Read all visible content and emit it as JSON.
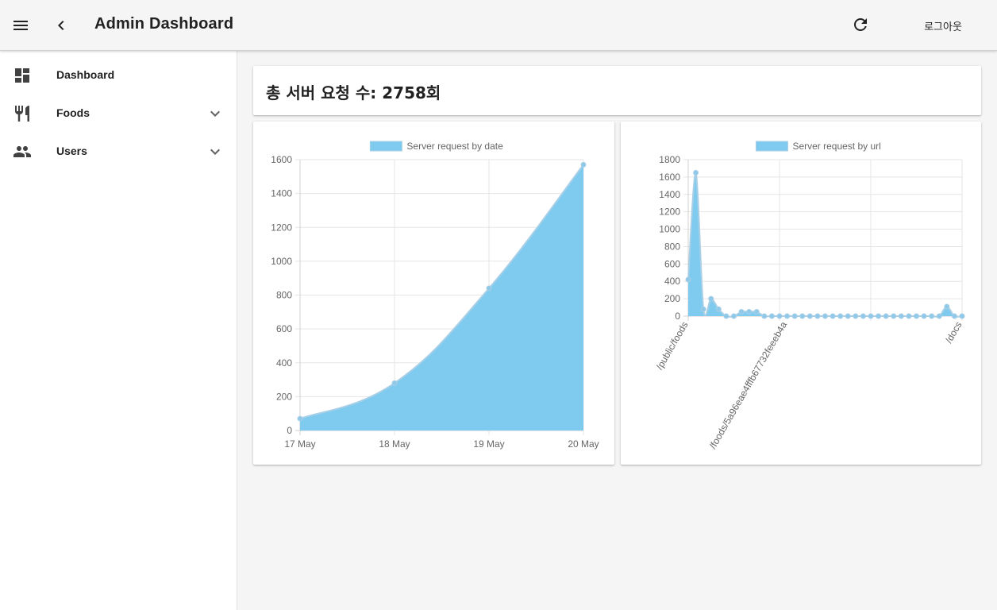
{
  "header": {
    "title": "Admin Dashboard",
    "logout_label": "로그아웃",
    "icons": [
      "menu-icon",
      "back-chevron-icon",
      "refresh-icon"
    ]
  },
  "sidebar": {
    "items": [
      {
        "label": "Dashboard",
        "icon": "dashboard-icon",
        "expandable": false
      },
      {
        "label": "Foods",
        "icon": "restaurant-icon",
        "expandable": true
      },
      {
        "label": "Users",
        "icon": "people-icon",
        "expandable": true
      }
    ]
  },
  "summary": {
    "total_requests": "총 서버 요청 수: 2758회"
  },
  "colors": {
    "fill": "#7ecbef",
    "stroke": "#a9cfe6",
    "point": "#8fc9ea",
    "grid": "#e5e5e5",
    "axis": "#d0d0d0"
  },
  "chart_data": [
    {
      "type": "area",
      "legend": "Server request by date",
      "categories": [
        "17 May",
        "18 May",
        "19 May",
        "20 May"
      ],
      "values": [
        70,
        280,
        840,
        1570
      ],
      "ylim": [
        0,
        1600
      ],
      "yticks": [
        0,
        200,
        400,
        600,
        800,
        1000,
        1200,
        1400,
        1600
      ],
      "grid": true,
      "legend_position": "top"
    },
    {
      "type": "area",
      "legend": "Server request by url",
      "point_count": 37,
      "values": [
        420,
        1650,
        80,
        200,
        80,
        0,
        0,
        50,
        50,
        50,
        0,
        0,
        0,
        0,
        0,
        0,
        0,
        0,
        0,
        0,
        0,
        0,
        0,
        0,
        0,
        0,
        0,
        0,
        0,
        0,
        0,
        0,
        0,
        0,
        110,
        0,
        0
      ],
      "visible_tick_labels": [
        {
          "index": 0,
          "label": "/public/foods"
        },
        {
          "index": 13,
          "label": "/foods/5a96eae4fffb67732feeeb4a"
        },
        {
          "index": 36,
          "label": "/docs"
        }
      ],
      "ylim": [
        0,
        1800
      ],
      "yticks": [
        0,
        200,
        400,
        600,
        800,
        1000,
        1200,
        1400,
        1600,
        1800
      ],
      "grid": true,
      "legend_position": "top"
    }
  ]
}
